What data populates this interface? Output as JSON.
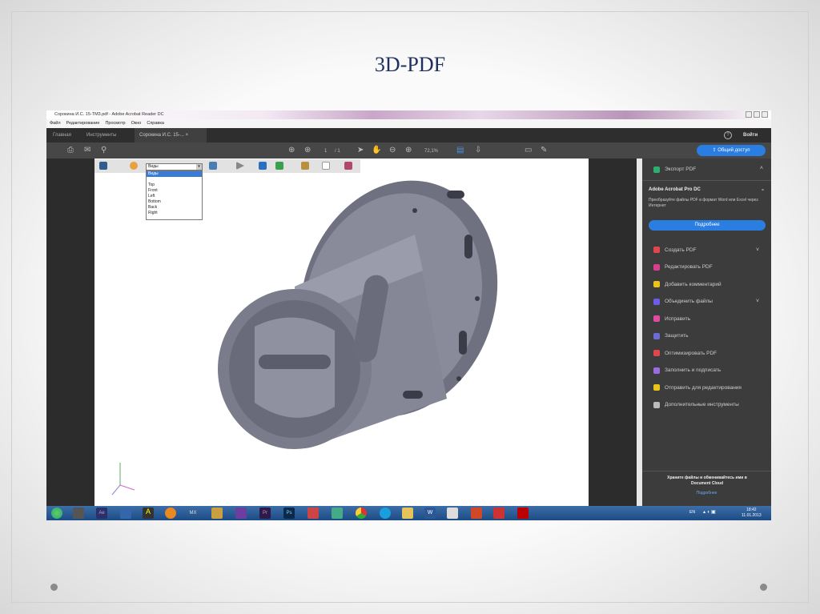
{
  "slide": {
    "title": "3D-PDF"
  },
  "window": {
    "title": "Сорокина И.С. 15-ТМ3.pdf - Adobe Acrobat Reader DC"
  },
  "menu": [
    "Файл",
    "Редактирование",
    "Просмотр",
    "Окно",
    "Справка"
  ],
  "tabs": {
    "home": "Главная",
    "tools": "Инструменты",
    "doc": "Сорокина И.С. 15-... ×"
  },
  "header": {
    "help": "?",
    "signin": "Войти"
  },
  "toolbar": {
    "page_current": "1",
    "page_total": "/ 1",
    "zoom": "72,1%",
    "share": "Общий доступ"
  },
  "toolbar3d": {
    "view_selected": "Виды",
    "view_options": [
      "Виды",
      "",
      "Top",
      "Front",
      "Left",
      "Bottom",
      "Back",
      "Right"
    ]
  },
  "panel": {
    "export": "Экспорт PDF",
    "promo_title": "Adobe Acrobat Pro DC",
    "promo_text": "Преобразуйте файлы PDF в формат Word или Excel через Интернет",
    "promo_button": "Подробнее",
    "items": [
      {
        "label": "Создать PDF",
        "color": "#e0474c",
        "chevron": true
      },
      {
        "label": "Редактировать PDF",
        "color": "#d93f8f"
      },
      {
        "label": "Добавить комментарий",
        "color": "#e8c31a"
      },
      {
        "label": "Объединить файлы",
        "color": "#6c5ce7",
        "chevron": true
      },
      {
        "label": "Исправить",
        "color": "#e04aa0"
      },
      {
        "label": "Защитить",
        "color": "#6c6cd0"
      },
      {
        "label": "Оптимизировать PDF",
        "color": "#e0474c"
      },
      {
        "label": "Заполнить и подписать",
        "color": "#9a6ce0"
      },
      {
        "label": "Отправить для редактирования",
        "color": "#e8c31a"
      },
      {
        "label": "Дополнительные инструменты",
        "color": "#bbbbbb"
      }
    ],
    "footer_text": "Храните файлы и обменивайтесь ими в Document Cloud",
    "footer_link": "Подробнее"
  },
  "taskbar": {
    "lang": "EN",
    "time": "18:42",
    "date": "11.01.2013",
    "apps": [
      "MX",
      "Ae",
      "Ps",
      "Pr",
      "W"
    ]
  }
}
